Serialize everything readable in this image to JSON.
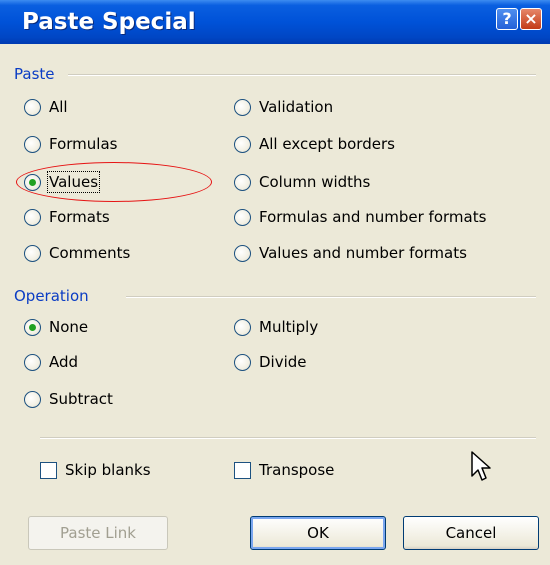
{
  "dialog": {
    "title": "Paste Special",
    "help_label": "?",
    "close_label": "×"
  },
  "paste": {
    "label": "Paste",
    "left": [
      "All",
      "Formulas",
      "Values",
      "Formats",
      "Comments"
    ],
    "right": [
      "Validation",
      "All except borders",
      "Column widths",
      "Formulas and number formats",
      "Values and number formats"
    ],
    "selected": "Values"
  },
  "operation": {
    "label": "Operation",
    "left": [
      "None",
      "Add",
      "Subtract"
    ],
    "right": [
      "Multiply",
      "Divide"
    ],
    "selected": "None"
  },
  "options": {
    "skip_blanks": "Skip blanks",
    "transpose": "Transpose"
  },
  "buttons": {
    "paste_link": "Paste Link",
    "ok": "OK",
    "cancel": "Cancel"
  },
  "colors": {
    "title_bar": "#0052d8",
    "section_label": "#0a3cc4",
    "radio_dot": "#21a121",
    "highlight_ellipse": "#e61414"
  },
  "icons": {
    "help": "help-icon",
    "close": "close-icon",
    "cursor": "mouse-pointer-icon"
  }
}
